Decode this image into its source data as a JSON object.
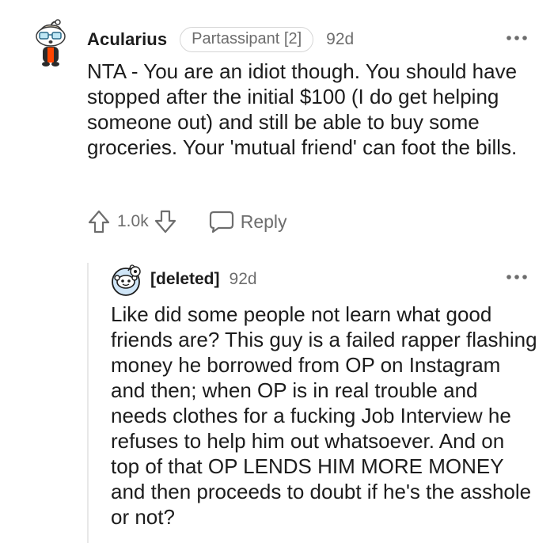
{
  "comment": {
    "username": "Acularius",
    "flair": "Partassipant [2]",
    "age": "92d",
    "avatar_icon": "snoo-avatar-glasses-icon",
    "more_icon": "more-options-icon",
    "body": "NTA - You are an idiot though. You should have stopped after the initial $100 (I do get helping someone out) and still be able to buy some groceries. Your 'mutual friend' can foot the bills.",
    "score": "1.0k",
    "upvote_icon": "upvote-arrow-icon",
    "downvote_icon": "downvote-arrow-icon",
    "reply_icon": "speech-bubble-icon",
    "reply_label": "Reply"
  },
  "reply": {
    "username": "[deleted]",
    "age": "92d",
    "avatar_icon": "deleted-user-avatar-icon",
    "more_icon": "more-options-icon",
    "body": "Like did some people not learn what good friends are? This guy is a failed rapper flashing money he borrowed from OP on Instagram and then; when OP is in real trouble and needs clothes for a fucking Job Interview he refuses to help him out whatsoever. And on top of that OP LENDS HIM MORE MONEY and then proceeds to doubt if he's the asshole or not?"
  },
  "colors": {
    "text": "#1c1c1c",
    "muted": "#6d6d6d",
    "border": "#d6d6d6",
    "thread_line": "#e8e8e8"
  }
}
